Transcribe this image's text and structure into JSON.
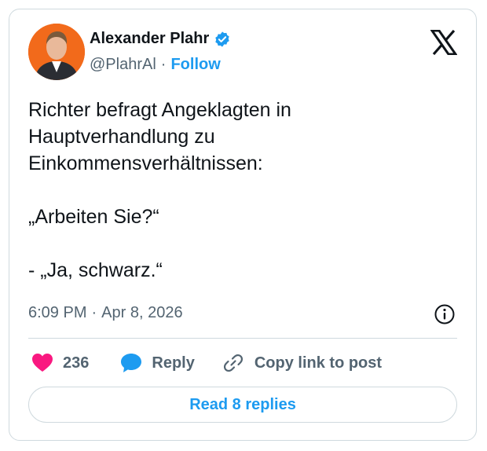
{
  "author": {
    "name": "Alexander Plahr",
    "handle": "@PlahrAl",
    "separator": "·",
    "follow_label": "Follow"
  },
  "tweet": {
    "text": "Richter befragt Angeklagten in\nHauptverhandlung zu\nEinkommensverhältnissen:\n\n„Arbeiten Sie?“\n\n- „Ja, schwarz.“",
    "time": "6:09 PM",
    "separator": "·",
    "date": "Apr 8, 2026"
  },
  "actions": {
    "like_count": "236",
    "reply_label": "Reply",
    "copy_label": "Copy link to post"
  },
  "read_replies_label": "Read 8 replies",
  "colors": {
    "accent": "#1d9bf0",
    "like": "#f91880",
    "avatar_bg": "#f26a1b",
    "secondary_text": "#536471",
    "border": "#cfd9de"
  },
  "icons": {
    "verified": "verified-badge-icon",
    "brand": "x-logo-icon",
    "info": "info-icon",
    "like": "heart-icon",
    "reply": "speech-bubble-icon",
    "copy": "link-icon"
  }
}
